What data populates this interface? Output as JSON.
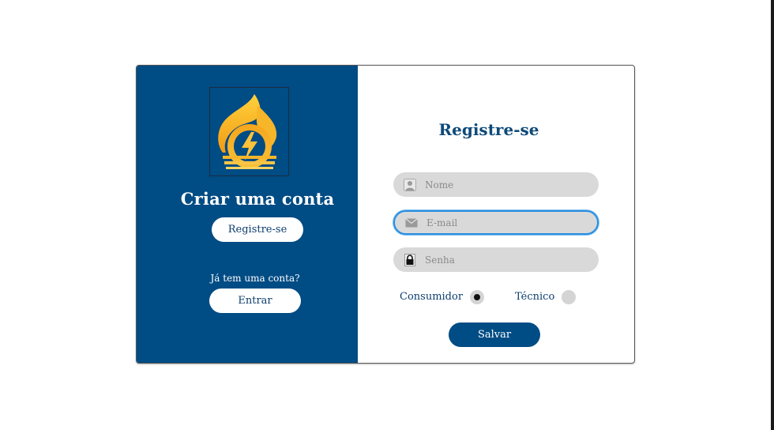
{
  "left_panel": {
    "title": "Criar uma conta",
    "register_label": "Registre-se",
    "login_prompt": "Já tem uma conta?",
    "login_label": "Entrar"
  },
  "form": {
    "title": "Registre-se",
    "name_placeholder": "Nome",
    "email_placeholder": "E-mail",
    "password_placeholder": "Senha",
    "role_options": [
      {
        "label": "Consumidor",
        "selected": true
      },
      {
        "label": "Técnico",
        "selected": false
      }
    ],
    "save_label": "Salvar"
  },
  "icons": {
    "logo": "flame-lightning-logo",
    "name_field": "user-icon",
    "email_field": "envelope-icon",
    "password_field": "lock-icon"
  },
  "colors": {
    "primary": "#004c84",
    "title_text": "#0d4a7a",
    "field_bg": "#d9d9d9",
    "focus_ring": "#2a8fe0",
    "logo_orange": "#f4a21a",
    "logo_yellow": "#ffcf3a"
  }
}
